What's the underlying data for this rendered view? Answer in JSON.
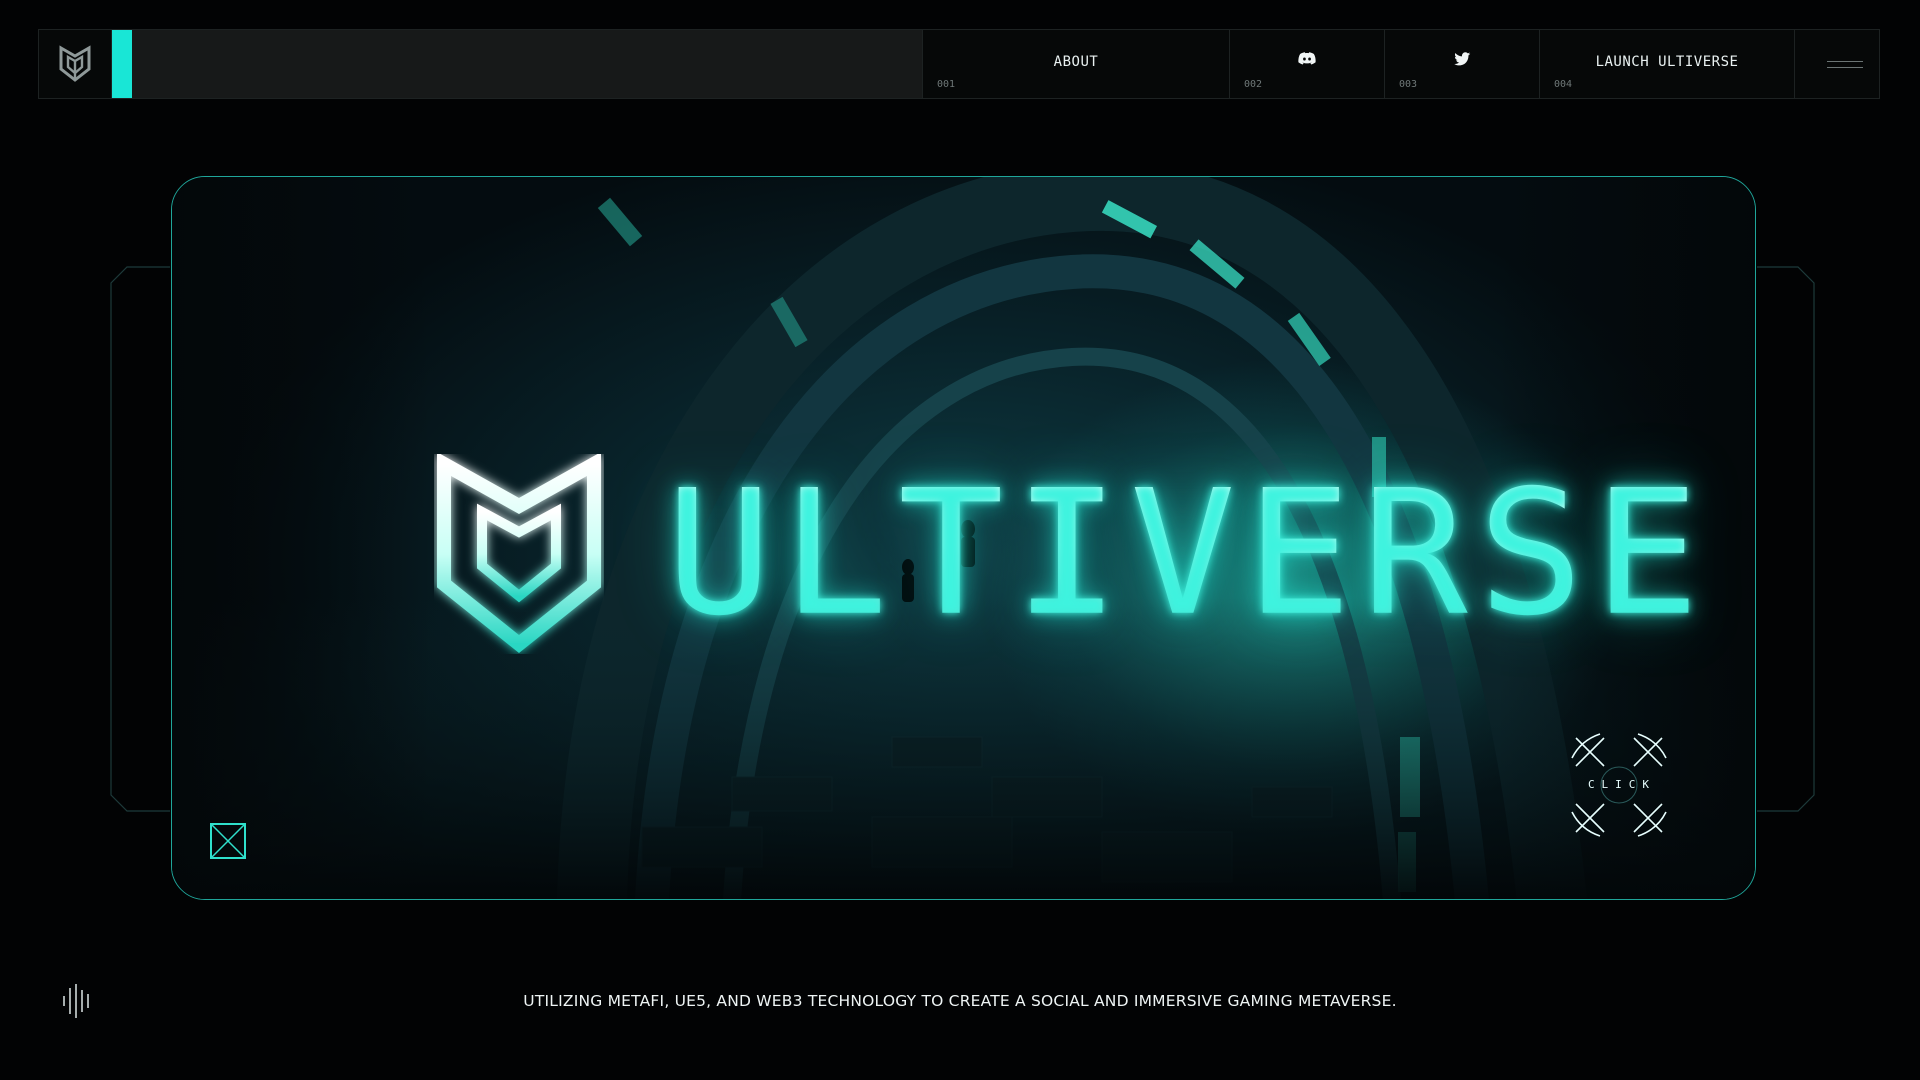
{
  "nav": {
    "logo_icon": "ulti-shield-logo-icon",
    "items": [
      {
        "label": "ABOUT",
        "num": "001"
      },
      {
        "label": "",
        "num": "002",
        "icon": "discord-icon"
      },
      {
        "label": "",
        "num": "003",
        "icon": "twitter-icon"
      },
      {
        "label": "LAUNCH ULTIVERSE",
        "num": "004"
      }
    ],
    "menu_icon": "menu-lines-icon"
  },
  "hero": {
    "brand_word": "ULTIVERSE",
    "brand_mark_icon": "ulti-shield-logo-icon",
    "corner_icon": "box-x-icon",
    "click_label": "CLICK"
  },
  "footer": {
    "sound_icon": "sound-bars-icon",
    "tagline": "UTILIZING METAFI, UE5, AND WEB3 TECHNOLOGY  TO CREATE A SOCIAL AND IMMERSIVE GAMING METAVERSE."
  },
  "colors": {
    "accent": "#19e6d6",
    "background": "#020304",
    "frame_border": "#1fa69a"
  }
}
